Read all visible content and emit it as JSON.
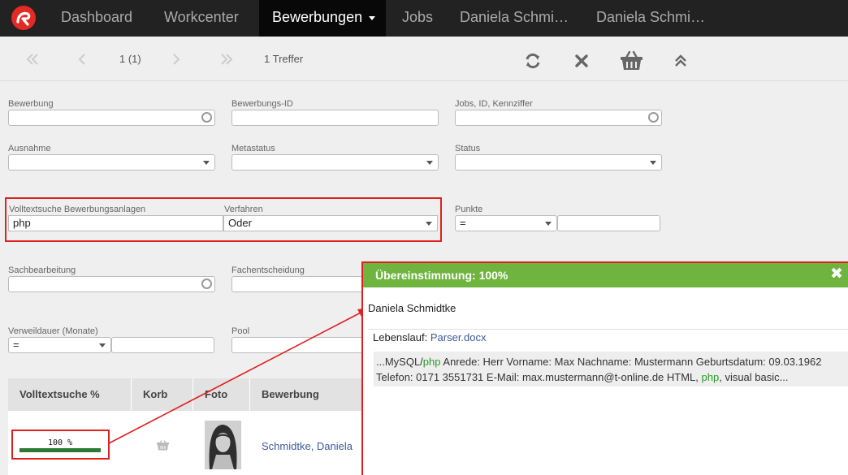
{
  "nav": {
    "items": [
      "Dashboard",
      "Workcenter",
      "Bewerbungen",
      "Jobs",
      "Daniela Schmi…",
      "Daniela Schmi…"
    ],
    "active_index": 2
  },
  "toolbar": {
    "page": "1 (1)",
    "hits": "1 Treffer",
    "icons": [
      "first-page-icon",
      "prev-page-icon",
      "next-page-icon",
      "last-page-icon",
      "refresh-icon",
      "clear-icon",
      "basket-icon",
      "collapse-icon"
    ]
  },
  "form": {
    "bewerbung": {
      "label": "Bewerbung",
      "value": ""
    },
    "bewerbungs_id": {
      "label": "Bewerbungs-ID",
      "value": ""
    },
    "jobs": {
      "label": "Jobs, ID, Kennziffer",
      "value": ""
    },
    "ausnahme": {
      "label": "Ausnahme",
      "value": ""
    },
    "metastatus": {
      "label": "Metastatus",
      "value": ""
    },
    "status": {
      "label": "Status",
      "value": ""
    },
    "volltext": {
      "label": "Volltextsuche Bewerbungsanlagen",
      "value": "php"
    },
    "verfahren": {
      "label": "Verfahren",
      "value": "Oder"
    },
    "punkte": {
      "label": "Punkte",
      "operator": "=",
      "value": ""
    },
    "sachbearbeitung": {
      "label": "Sachbearbeitung",
      "value": ""
    },
    "fachentscheidung": {
      "label": "Fachentscheidung",
      "value": ""
    },
    "verweildauer": {
      "label": "Verweildauer (Monate)",
      "operator": "=",
      "value": ""
    },
    "pool": {
      "label": "Pool",
      "value": ""
    }
  },
  "table": {
    "headers": [
      "Volltextsuche %",
      "Korb",
      "Foto",
      "Bewerbung"
    ],
    "rows": [
      {
        "match_text": "100 %",
        "match_value": 100,
        "name": "Schmidtke, Daniela"
      }
    ]
  },
  "popup": {
    "title": "Übereinstimmung: 100%",
    "name": "Daniela Schmidtke",
    "cv_label": "Lebenslauf:",
    "cv_file": "Parser.docx",
    "snippet": [
      {
        "t": "...MySQL/",
        "hl": false
      },
      {
        "t": "php",
        "hl": true
      },
      {
        "t": " Anrede: Herr Vorname: Max Nachname: Mustermann Geburtsdatum: 09.03.1962 Telefon: 0171 3551731 E-Mail: max.mustermann@t-online.de HTML, ",
        "hl": false
      },
      {
        "t": "php",
        "hl": true
      },
      {
        "t": ", visual basic...",
        "hl": false
      }
    ]
  },
  "colors": {
    "accent_green": "#6fb43f",
    "highlight_red": "#e0201e",
    "link_blue": "#3d5a99",
    "progress_green": "#2c7a34"
  }
}
